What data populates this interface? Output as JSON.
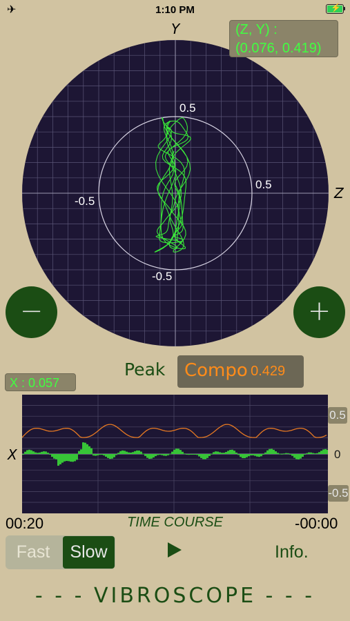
{
  "status": {
    "time": "1:10 PM",
    "airplane_icon": "airplane-icon",
    "battery_icon": "battery-charging-icon"
  },
  "scope": {
    "y_axis": "Y",
    "z_axis": "Z",
    "readout_line1": "(Z, Y)  :",
    "readout_line2": "(0.076, 0.419)",
    "labels": {
      "top": "0.5",
      "right": "0.5",
      "left": "-0.5",
      "bottom": "-0.5"
    },
    "background": "#1d1634",
    "trace_color": "#39e639"
  },
  "buttons": {
    "minus": "−",
    "plus": "+"
  },
  "peak": {
    "label": "Peak",
    "compo_label": "Compo",
    "compo_value": ": 0.429"
  },
  "trace_panel": {
    "x_readout": "X : 0.057",
    "axis_letter": "X",
    "tick_top": "0.5",
    "tick_mid": "0",
    "tick_bottom": "-0.5",
    "time_left": "00:20",
    "time_right": "-00:00",
    "title": "TIME COURSE"
  },
  "controls": {
    "fast": "Fast",
    "slow": "Slow",
    "play_icon": "play-icon",
    "info": "Info."
  },
  "footer": "- - - VIBROSCOPE - - -",
  "colors": {
    "accent": "#1b4d14",
    "orange": "#ff8c1a",
    "green_trace": "#39e639",
    "background": "#d1c3a1"
  }
}
